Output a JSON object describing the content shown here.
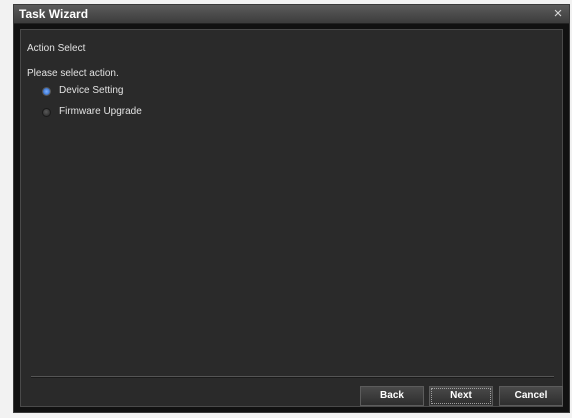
{
  "window": {
    "title": "Task Wizard",
    "close_glyph": "×"
  },
  "panel": {
    "section_title": "Action Select",
    "prompt": "Please select action."
  },
  "options": [
    {
      "label": "Device Setting",
      "selected": true
    },
    {
      "label": "Firmware Upgrade",
      "selected": false
    }
  ],
  "buttons": {
    "back": "Back",
    "next": "Next",
    "cancel": "Cancel"
  },
  "colors": {
    "accent": "#4d87e0",
    "background": "#2a2a2a",
    "titlebar": "#4a4a4a"
  },
  "icons": {
    "close": "close-icon"
  }
}
